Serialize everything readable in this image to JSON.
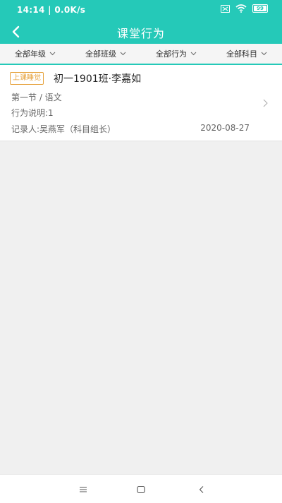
{
  "status_bar": {
    "time": "14:14 | 0.0K/s",
    "battery": "99",
    "icons": [
      "sim-card-icon",
      "wifi-icon",
      "battery-icon"
    ]
  },
  "nav": {
    "title": "课堂行为",
    "back_icon": "chevron-left-icon"
  },
  "filters": [
    {
      "label": "全部年级"
    },
    {
      "label": "全部班级"
    },
    {
      "label": "全部行为"
    },
    {
      "label": "全部科目"
    }
  ],
  "records": [
    {
      "tag": "上课睡觉",
      "title": "初一1901班·李嘉如",
      "meta": "第一节  /  语文",
      "description": "行为说明:1",
      "recorder": "记录人:吴燕军（科目组长）",
      "date": "2020-08-27"
    }
  ],
  "colors": {
    "accent": "#25c9b8",
    "tag": "#e6a23c",
    "background": "#f0f0f0"
  },
  "system_nav": {
    "icons": [
      "menu-icon",
      "home-icon",
      "back-icon"
    ]
  }
}
